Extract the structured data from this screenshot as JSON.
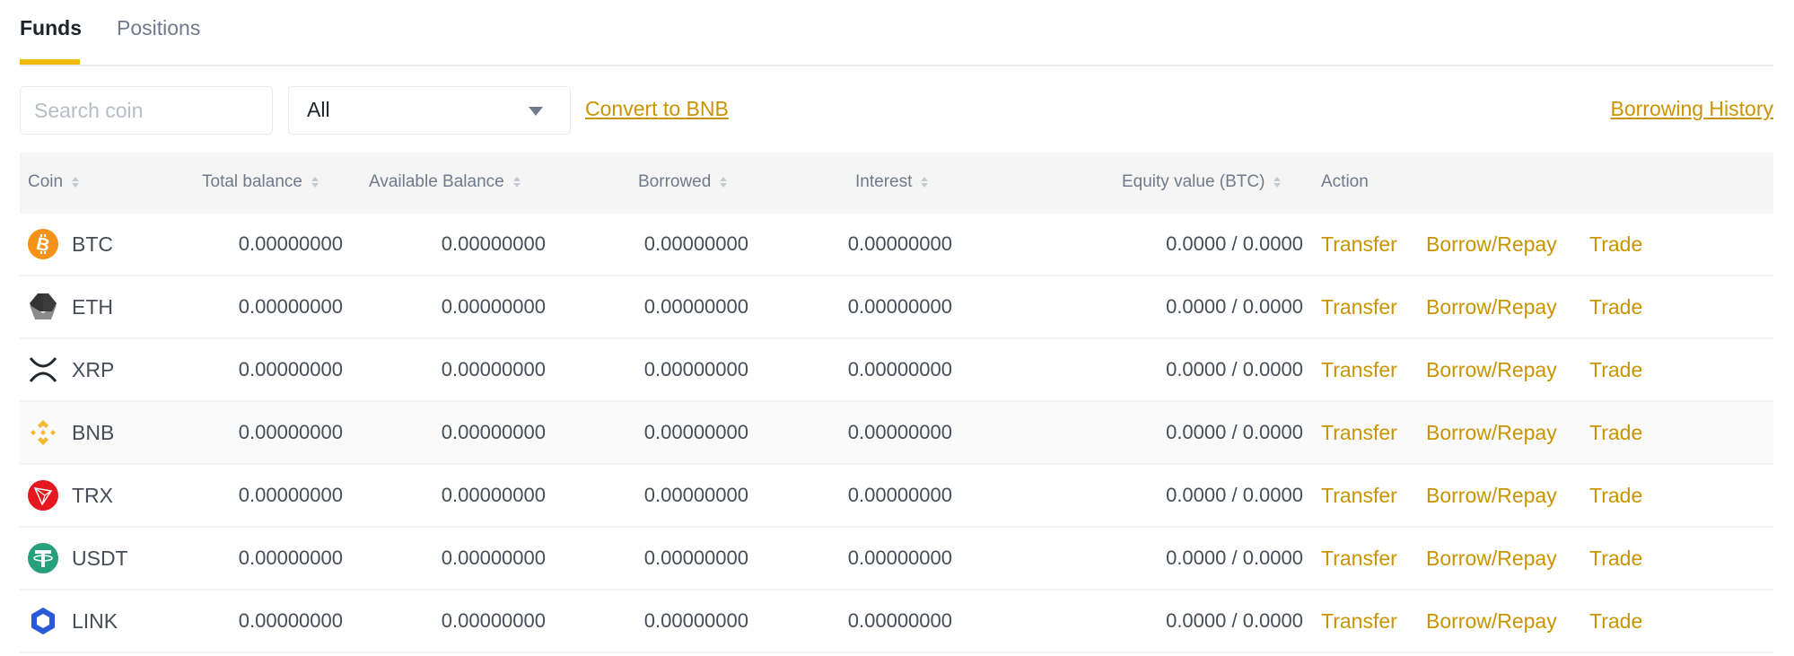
{
  "tabs": [
    {
      "label": "Funds",
      "active": true
    },
    {
      "label": "Positions",
      "active": false
    }
  ],
  "toolbar": {
    "search_placeholder": "Search coin",
    "search_value": "",
    "filter_selected": "All",
    "convert_link": "Convert to BNB",
    "history_link": "Borrowing History"
  },
  "colors": {
    "accent": "#f0b90b",
    "link": "#c99400",
    "header_bg": "#f5f5f5"
  },
  "table": {
    "columns": [
      {
        "label": "Coin",
        "sortable": true
      },
      {
        "label": "Total balance",
        "sortable": true
      },
      {
        "label": "Available Balance",
        "sortable": true
      },
      {
        "label": "Borrowed",
        "sortable": true
      },
      {
        "label": "Interest",
        "sortable": true
      },
      {
        "label": "Equity value (BTC)",
        "sortable": true
      },
      {
        "label": "Action",
        "sortable": false
      }
    ],
    "actions": {
      "transfer": "Transfer",
      "borrow_repay": "Borrow/Repay",
      "trade": "Trade"
    },
    "rows": [
      {
        "coin": "BTC",
        "icon": "bitcoin-icon",
        "total": "0.00000000",
        "available": "0.00000000",
        "borrowed": "0.00000000",
        "interest": "0.00000000",
        "equity": "0.0000 / 0.0000"
      },
      {
        "coin": "ETH",
        "icon": "ethereum-icon",
        "total": "0.00000000",
        "available": "0.00000000",
        "borrowed": "0.00000000",
        "interest": "0.00000000",
        "equity": "0.0000 / 0.0000"
      },
      {
        "coin": "XRP",
        "icon": "xrp-icon",
        "total": "0.00000000",
        "available": "0.00000000",
        "borrowed": "0.00000000",
        "interest": "0.00000000",
        "equity": "0.0000 / 0.0000"
      },
      {
        "coin": "BNB",
        "icon": "bnb-icon",
        "total": "0.00000000",
        "available": "0.00000000",
        "borrowed": "0.00000000",
        "interest": "0.00000000",
        "equity": "0.0000 / 0.0000"
      },
      {
        "coin": "TRX",
        "icon": "tron-icon",
        "total": "0.00000000",
        "available": "0.00000000",
        "borrowed": "0.00000000",
        "interest": "0.00000000",
        "equity": "0.0000 / 0.0000"
      },
      {
        "coin": "USDT",
        "icon": "tether-icon",
        "total": "0.00000000",
        "available": "0.00000000",
        "borrowed": "0.00000000",
        "interest": "0.00000000",
        "equity": "0.0000 / 0.0000"
      },
      {
        "coin": "LINK",
        "icon": "chainlink-icon",
        "total": "0.00000000",
        "available": "0.00000000",
        "borrowed": "0.00000000",
        "interest": "0.00000000",
        "equity": "0.0000 / 0.0000"
      }
    ]
  }
}
